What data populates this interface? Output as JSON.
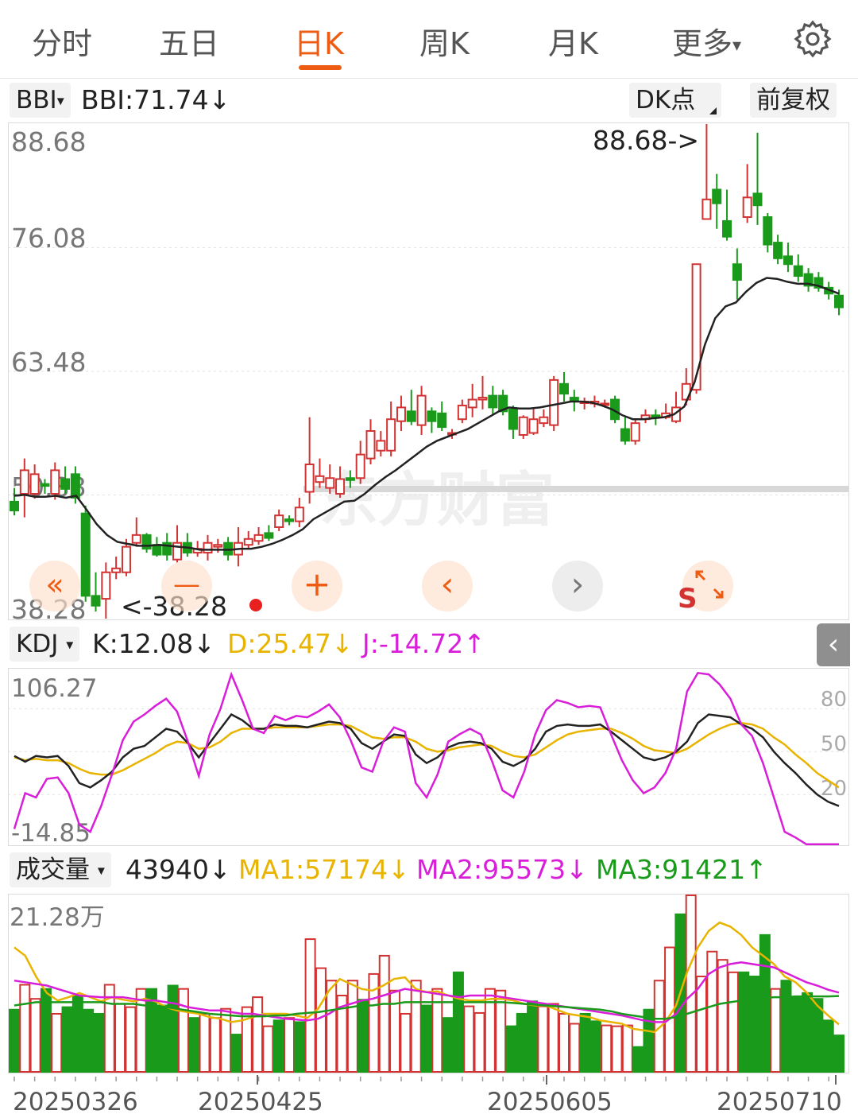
{
  "nav": {
    "tabs": [
      {
        "label": "分时"
      },
      {
        "label": "五日"
      },
      {
        "label": "日K",
        "active": true
      },
      {
        "label": "周K"
      },
      {
        "label": "月K"
      },
      {
        "label": "更多"
      }
    ],
    "more_arrow": "▾",
    "settings_icon": "gear-icon"
  },
  "main_header": {
    "indicator_select": "BBI",
    "indicator_value": "BBI:71.74↓",
    "dk_button": "DK点",
    "adjust_button": "前复权"
  },
  "main_chart": {
    "watermark": "东方财富",
    "y_labels": [
      "88.68",
      "76.08",
      "63.48",
      "50.88",
      "38.28"
    ],
    "max_label": "88.68->",
    "min_label": "<-38.28",
    "controls": [
      "«",
      "—",
      "+",
      "‹",
      "›",
      "S"
    ]
  },
  "kdj_header": {
    "select": "KDJ",
    "k": "K:12.08↓",
    "d": "D:25.47↓",
    "j": "J:-14.72↑"
  },
  "kdj_chart": {
    "y_top": "106.27",
    "y_bottom": "-14.85",
    "levels": [
      "80",
      "50",
      "20"
    ]
  },
  "vol_header": {
    "select": "成交量",
    "value": "43940↓",
    "ma1": "MA1:57174↓",
    "ma2": "MA2:95573↓",
    "ma3": "MA3:91421↑"
  },
  "vol_chart": {
    "y_top": "21.28万"
  },
  "x_axis": {
    "dates": [
      "20250326",
      "20250425",
      "20250605",
      "20250710"
    ]
  },
  "colors": {
    "up": "#d23232",
    "down": "#1a9a1a",
    "accent": "#ee5b12",
    "kdj_k": "#222222",
    "kdj_d": "#e8b400",
    "kdj_j": "#d81ed8",
    "ma1": "#e8b400",
    "ma2": "#d81ed8",
    "ma3": "#1a9a1a"
  },
  "chart_data": {
    "type": "candlestick",
    "ylim": [
      38.28,
      88.68
    ],
    "candles": [
      {
        "o": 50.2,
        "c": 49.3,
        "h": 51.6,
        "l": 48.8
      },
      {
        "o": 51.0,
        "c": 53.4,
        "h": 54.6,
        "l": 48.6
      },
      {
        "o": 51.0,
        "c": 53.0,
        "h": 54.0,
        "l": 50.5
      },
      {
        "o": 52.0,
        "c": 51.8,
        "h": 52.5,
        "l": 51.0
      },
      {
        "o": 51.0,
        "c": 53.4,
        "h": 54.2,
        "l": 50.4
      },
      {
        "o": 52.5,
        "c": 51.5,
        "h": 53.8,
        "l": 51.0
      },
      {
        "o": 53.0,
        "c": 50.6,
        "h": 53.8,
        "l": 50.0
      },
      {
        "o": 49.0,
        "c": 40.6,
        "h": 49.8,
        "l": 40.0
      },
      {
        "o": 40.6,
        "c": 39.6,
        "h": 43.0,
        "l": 39.0
      },
      {
        "o": 40.3,
        "c": 43.0,
        "h": 44.0,
        "l": 38.28
      },
      {
        "o": 43.0,
        "c": 43.4,
        "h": 44.6,
        "l": 42.3
      },
      {
        "o": 43.0,
        "c": 45.6,
        "h": 46.4,
        "l": 42.6
      },
      {
        "o": 46.0,
        "c": 46.8,
        "h": 48.6,
        "l": 45.6
      },
      {
        "o": 46.8,
        "c": 45.4,
        "h": 47.0,
        "l": 45.0
      },
      {
        "o": 45.8,
        "c": 44.8,
        "h": 46.6,
        "l": 44.6
      },
      {
        "o": 46.0,
        "c": 44.8,
        "h": 47.0,
        "l": 44.2
      },
      {
        "o": 44.3,
        "c": 46.0,
        "h": 47.8,
        "l": 44.0
      },
      {
        "o": 46.0,
        "c": 45.0,
        "h": 47.0,
        "l": 44.6
      },
      {
        "o": 45.0,
        "c": 45.4,
        "h": 46.2,
        "l": 44.6
      },
      {
        "o": 45.0,
        "c": 46.0,
        "h": 46.8,
        "l": 44.2
      },
      {
        "o": 45.6,
        "c": 45.8,
        "h": 46.4,
        "l": 45.0
      },
      {
        "o": 46.0,
        "c": 44.8,
        "h": 46.6,
        "l": 44.2
      },
      {
        "o": 44.8,
        "c": 46.0,
        "h": 47.6,
        "l": 43.6
      },
      {
        "o": 45.8,
        "c": 46.4,
        "h": 47.2,
        "l": 45.4
      },
      {
        "o": 46.2,
        "c": 46.8,
        "h": 47.6,
        "l": 45.8
      },
      {
        "o": 47.0,
        "c": 46.5,
        "h": 47.8,
        "l": 46.2
      },
      {
        "o": 47.6,
        "c": 48.8,
        "h": 49.4,
        "l": 47.2
      },
      {
        "o": 48.4,
        "c": 48.2,
        "h": 48.8,
        "l": 47.8
      },
      {
        "o": 48.2,
        "c": 49.6,
        "h": 50.6,
        "l": 47.6
      },
      {
        "o": 51.2,
        "c": 54.0,
        "h": 58.8,
        "l": 50.0
      },
      {
        "o": 52.2,
        "c": 52.8,
        "h": 54.6,
        "l": 51.6
      },
      {
        "o": 51.6,
        "c": 52.6,
        "h": 54.0,
        "l": 51.0
      },
      {
        "o": 51.0,
        "c": 52.5,
        "h": 53.8,
        "l": 50.6
      },
      {
        "o": 52.6,
        "c": 52.4,
        "h": 53.4,
        "l": 51.6
      },
      {
        "o": 52.6,
        "c": 55.0,
        "h": 56.4,
        "l": 52.0
      },
      {
        "o": 54.6,
        "c": 57.4,
        "h": 58.6,
        "l": 54.0
      },
      {
        "o": 55.4,
        "c": 56.4,
        "h": 57.4,
        "l": 54.8
      },
      {
        "o": 55.4,
        "c": 58.6,
        "h": 60.4,
        "l": 54.8
      },
      {
        "o": 58.4,
        "c": 59.8,
        "h": 61.0,
        "l": 57.4
      },
      {
        "o": 59.4,
        "c": 58.4,
        "h": 61.6,
        "l": 58.0
      },
      {
        "o": 58.0,
        "c": 61.0,
        "h": 62.0,
        "l": 57.0
      },
      {
        "o": 59.4,
        "c": 58.4,
        "h": 59.8,
        "l": 57.2
      },
      {
        "o": 59.2,
        "c": 57.8,
        "h": 60.4,
        "l": 57.4
      },
      {
        "o": 57.2,
        "c": 57.2,
        "h": 57.6,
        "l": 56.6
      },
      {
        "o": 58.6,
        "c": 60.0,
        "h": 60.6,
        "l": 58.2
      },
      {
        "o": 59.8,
        "c": 60.6,
        "h": 62.2,
        "l": 58.8
      },
      {
        "o": 60.6,
        "c": 60.8,
        "h": 63.0,
        "l": 59.6
      },
      {
        "o": 61.0,
        "c": 59.8,
        "h": 62.0,
        "l": 59.0
      },
      {
        "o": 61.0,
        "c": 59.4,
        "h": 61.6,
        "l": 59.0
      },
      {
        "o": 59.6,
        "c": 57.6,
        "h": 60.0,
        "l": 56.6
      },
      {
        "o": 57.0,
        "c": 58.8,
        "h": 59.0,
        "l": 56.6
      },
      {
        "o": 57.2,
        "c": 58.6,
        "h": 59.8,
        "l": 57.0
      },
      {
        "o": 58.2,
        "c": 58.8,
        "h": 59.6,
        "l": 57.8
      },
      {
        "o": 58.0,
        "c": 62.6,
        "h": 63.0,
        "l": 57.4
      },
      {
        "o": 62.2,
        "c": 61.2,
        "h": 63.4,
        "l": 60.4
      },
      {
        "o": 60.8,
        "c": 60.4,
        "h": 61.6,
        "l": 59.4
      },
      {
        "o": 60.4,
        "c": 60.4,
        "h": 60.8,
        "l": 59.6
      },
      {
        "o": 60.2,
        "c": 60.4,
        "h": 61.0,
        "l": 59.8
      },
      {
        "o": 60.2,
        "c": 60.2,
        "h": 60.6,
        "l": 59.8
      },
      {
        "o": 60.6,
        "c": 58.6,
        "h": 61.0,
        "l": 58.2
      },
      {
        "o": 57.6,
        "c": 56.4,
        "h": 58.8,
        "l": 56.0
      },
      {
        "o": 56.4,
        "c": 58.2,
        "h": 58.6,
        "l": 56.0
      },
      {
        "o": 58.6,
        "c": 59.0,
        "h": 59.6,
        "l": 58.2
      },
      {
        "o": 59.0,
        "c": 58.8,
        "h": 59.6,
        "l": 58.0
      },
      {
        "o": 58.8,
        "c": 59.2,
        "h": 60.2,
        "l": 58.6
      },
      {
        "o": 58.4,
        "c": 59.8,
        "h": 61.4,
        "l": 58.2
      },
      {
        "o": 60.6,
        "c": 62.2,
        "h": 63.8,
        "l": 60.0
      },
      {
        "o": 61.6,
        "c": 74.4,
        "h": 74.4,
        "l": 61.2
      },
      {
        "o": 79.0,
        "c": 81.0,
        "h": 88.68,
        "l": 79.0
      },
      {
        "o": 82.0,
        "c": 80.6,
        "h": 83.6,
        "l": 78.0
      },
      {
        "o": 78.8,
        "c": 77.2,
        "h": 82.0,
        "l": 76.8
      },
      {
        "o": 74.4,
        "c": 72.8,
        "h": 76.0,
        "l": 70.8
      },
      {
        "o": 79.2,
        "c": 81.2,
        "h": 84.6,
        "l": 78.6
      },
      {
        "o": 81.6,
        "c": 80.4,
        "h": 87.8,
        "l": 78.4
      },
      {
        "o": 79.2,
        "c": 76.4,
        "h": 79.6,
        "l": 75.6
      },
      {
        "o": 76.6,
        "c": 75.0,
        "h": 77.4,
        "l": 74.4
      },
      {
        "o": 75.2,
        "c": 74.4,
        "h": 76.6,
        "l": 73.6
      },
      {
        "o": 74.2,
        "c": 73.2,
        "h": 75.4,
        "l": 72.6
      },
      {
        "o": 73.4,
        "c": 72.2,
        "h": 74.0,
        "l": 71.6
      },
      {
        "o": 73.0,
        "c": 72.0,
        "h": 73.6,
        "l": 71.6
      },
      {
        "o": 72.0,
        "c": 71.4,
        "h": 72.6,
        "l": 70.8
      },
      {
        "o": 71.2,
        "c": 70.0,
        "h": 71.8,
        "l": 69.2
      }
    ],
    "bbi": [
      50.8,
      50.9,
      50.7,
      50.7,
      50.8,
      50.6,
      50.8,
      49.4,
      47.9,
      46.8,
      46.1,
      45.9,
      45.7,
      45.7,
      45.8,
      45.7,
      45.6,
      45.5,
      45.3,
      45.3,
      45.3,
      45.3,
      45.4,
      45.4,
      45.6,
      45.9,
      46.3,
      46.8,
      47.4,
      48.4,
      49.0,
      49.6,
      50.2,
      50.3,
      51.0,
      51.9,
      52.7,
      53.4,
      54.2,
      55.0,
      55.8,
      56.4,
      56.8,
      57.2,
      57.6,
      58.2,
      58.8,
      59.4,
      59.8,
      59.7,
      59.7,
      59.8,
      60.0,
      60.2,
      60.4,
      60.4,
      60.3,
      60.0,
      59.6,
      59.0,
      58.6,
      58.6,
      58.7,
      58.8,
      59.1,
      59.9,
      62.4,
      66.2,
      68.9,
      70.1,
      70.5,
      71.6,
      72.5,
      73.0,
      72.9,
      72.6,
      72.4,
      72.4,
      72.2,
      71.8,
      71.4
    ]
  },
  "kdj_data": {
    "ylim": [
      -14.85,
      106.27
    ],
    "K": [
      47,
      43,
      47,
      46,
      47,
      40,
      28,
      25,
      30,
      36,
      46,
      52,
      54,
      60,
      66,
      64,
      56,
      46,
      56,
      66,
      76,
      72,
      66,
      66,
      69,
      68,
      68,
      67,
      69,
      71,
      70,
      66,
      56,
      52,
      57,
      62,
      61,
      48,
      42,
      46,
      53,
      56,
      57,
      56,
      52,
      43,
      40,
      44,
      52,
      64,
      68,
      69,
      68,
      68,
      69,
      64,
      58,
      52,
      46,
      44,
      46,
      50,
      57,
      70,
      76,
      75,
      74,
      69,
      66,
      60,
      50,
      42,
      35,
      27,
      20,
      15,
      12
    ],
    "D": [
      46,
      44,
      45,
      44,
      44,
      42,
      38,
      35,
      34,
      34,
      37,
      41,
      45,
      49,
      54,
      57,
      56,
      52,
      53,
      57,
      63,
      66,
      66,
      66,
      67,
      67,
      67,
      67,
      68,
      69,
      69,
      68,
      64,
      60,
      59,
      60,
      60,
      57,
      52,
      50,
      51,
      53,
      54,
      55,
      54,
      50,
      47,
      46,
      48,
      53,
      58,
      62,
      64,
      65,
      66,
      66,
      63,
      59,
      54,
      51,
      50,
      49,
      52,
      57,
      62,
      66,
      69,
      70,
      69,
      66,
      60,
      55,
      48,
      42,
      35,
      30,
      25
    ],
    "J": [
      -4,
      21,
      18,
      31,
      32,
      21,
      -1,
      -6,
      12,
      34,
      58,
      71,
      76,
      82,
      87,
      78,
      57,
      33,
      62,
      80,
      104,
      86,
      66,
      63,
      75,
      72,
      75,
      74,
      78,
      83,
      74,
      58,
      39,
      36,
      57,
      67,
      64,
      28,
      18,
      34,
      57,
      62,
      66,
      62,
      44,
      23,
      18,
      36,
      62,
      79,
      86,
      84,
      81,
      82,
      81,
      62,
      44,
      30,
      21,
      25,
      35,
      52,
      92,
      105,
      104,
      97,
      87,
      69,
      61,
      42,
      18,
      -6,
      -10,
      -14.72,
      -14.72,
      -14.72,
      -14.72
    ]
  },
  "vol_data": {
    "max": 212800,
    "values": [
      75000,
      105000,
      88000,
      100000,
      70000,
      78000,
      92000,
      75000,
      70000,
      105000,
      82000,
      78000,
      100000,
      100000,
      80000,
      104000,
      100000,
      65000,
      70000,
      65000,
      76000,
      45000,
      78000,
      90000,
      55000,
      62000,
      65000,
      60000,
      160000,
      125000,
      110000,
      92000,
      110000,
      87000,
      118000,
      140000,
      98000,
      70000,
      110000,
      80000,
      100000,
      65000,
      120000,
      79000,
      71000,
      100000,
      98000,
      55000,
      70000,
      85000,
      79000,
      82000,
      70000,
      58000,
      70000,
      61000,
      56000,
      55000,
      56000,
      30000,
      75000,
      110000,
      150000,
      190000,
      212800,
      115000,
      145000,
      135000,
      120000,
      120000,
      115000,
      165000,
      100000,
      110000,
      90000,
      95000,
      88000,
      62000,
      43940
    ],
    "ma1": [
      150000,
      140000,
      115000,
      95000,
      86000,
      90000,
      95000,
      90000,
      85000,
      90000,
      87000,
      85000,
      88000,
      85000,
      78000,
      74000,
      72000,
      70000,
      66000,
      64000,
      60000,
      62000,
      66000,
      70000,
      70000,
      70000,
      68000,
      65000,
      76000,
      98000,
      112000,
      106000,
      100000,
      98000,
      104000,
      112000,
      114000,
      100000,
      96000,
      97000,
      92000,
      88000,
      86000,
      86000,
      88000,
      88000,
      86000,
      82000,
      80000,
      80000,
      75000,
      70000,
      68000,
      66000,
      62000,
      60000,
      58000,
      52000,
      50000,
      48000,
      60000,
      80000,
      120000,
      150000,
      170000,
      180000,
      175000,
      165000,
      150000,
      140000,
      130000,
      115000,
      108000,
      96000,
      80000,
      68000,
      57174
    ],
    "ma2": [
      110000,
      108000,
      106000,
      104000,
      100000,
      96000,
      92000,
      91000,
      90000,
      90000,
      90000,
      88000,
      86000,
      86000,
      84000,
      82000,
      78000,
      76000,
      74000,
      74000,
      72000,
      70000,
      70000,
      68000,
      66000,
      64000,
      63000,
      62000,
      64000,
      70000,
      78000,
      82000,
      86000,
      88000,
      92000,
      96000,
      100000,
      98000,
      96000,
      94000,
      92000,
      90000,
      92000,
      92000,
      92000,
      90000,
      88000,
      86000,
      84000,
      82000,
      80000,
      78000,
      76000,
      74000,
      72000,
      70000,
      68000,
      65000,
      62000,
      60000,
      60000,
      70000,
      88000,
      100000,
      118000,
      126000,
      130000,
      132000,
      130000,
      128000,
      126000,
      120000,
      114000,
      108000,
      104000,
      99000,
      95573
    ],
    "ma3": [
      80000,
      82000,
      84000,
      84000,
      84000,
      84000,
      84000,
      84000,
      84000,
      82000,
      82000,
      82000,
      80000,
      80000,
      78000,
      76000,
      74000,
      72000,
      70000,
      69000,
      68000,
      67000,
      67000,
      67000,
      68000,
      68000,
      70000,
      71000,
      72000,
      74000,
      76000,
      78000,
      80000,
      80000,
      82000,
      82000,
      84000,
      84000,
      84000,
      84000,
      84000,
      84000,
      84000,
      84000,
      84000,
      84000,
      83000,
      82000,
      81000,
      80000,
      79000,
      78000,
      77000,
      76000,
      75000,
      73000,
      70000,
      68000,
      66000,
      64000,
      64000,
      66000,
      70000,
      74000,
      78000,
      82000,
      84000,
      86000,
      88000,
      89000,
      90000,
      90000,
      91000,
      91000,
      91000,
      91000,
      91421
    ]
  }
}
